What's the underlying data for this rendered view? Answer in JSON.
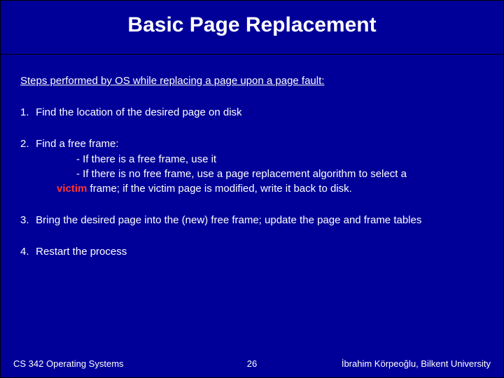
{
  "title": "Basic Page Replacement",
  "intro": "Steps performed by OS while replacing a page upon a page fault:",
  "steps": {
    "s1": {
      "num": "1.",
      "text": "Find the location of the desired page on disk"
    },
    "s2": {
      "num": "2.",
      "lead": "Find a free frame:",
      "bul1": "-  If there is a free frame, use it",
      "bul2": "-  If there is no free frame, use a page replacement algorithm to select a",
      "victim": "victim",
      "tail": " frame; if the victim page is modified, write it back to disk."
    },
    "s3": {
      "num": "3.",
      "text": "Bring  the desired page into the (new) free frame; update the page and frame tables"
    },
    "s4": {
      "num": "4.",
      "text": "Restart the process"
    }
  },
  "footer": {
    "left": "CS 342 Operating Systems",
    "center": "26",
    "right": "İbrahim Körpeoğlu, Bilkent University"
  }
}
